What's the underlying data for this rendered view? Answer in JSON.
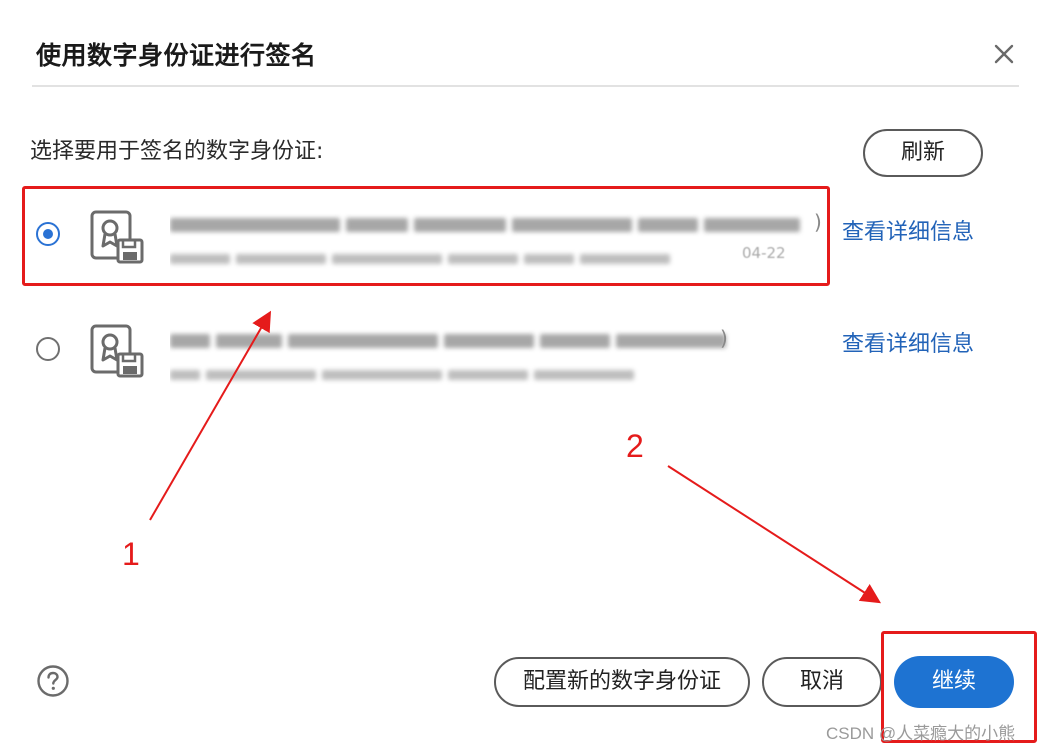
{
  "dialog": {
    "title": "使用数字身份证进行签名",
    "close_icon": "close-icon",
    "prompt": "选择要用于签名的数字身份证:",
    "refresh_label": "刷新"
  },
  "certificates": [
    {
      "selected": true,
      "icon": "certificate-icon",
      "details_label": "查看详细信息",
      "tail_line1": ")",
      "tail_line2": "04-22"
    },
    {
      "selected": false,
      "icon": "certificate-icon",
      "details_label": "查看详细信息",
      "tail_line1": ")",
      "tail_line2": ""
    }
  ],
  "footer": {
    "help_icon": "help-icon",
    "new_id_label": "配置新的数字身份证",
    "cancel_label": "取消",
    "continue_label": "继续"
  },
  "annotations": {
    "label_1": "1",
    "label_2": "2",
    "color": "#e51b1b"
  },
  "watermark": "CSDN @人菜瘾大的小熊",
  "colors": {
    "accent": "#1e73d2",
    "link": "#2263b8",
    "annotation_red": "#e51b1b"
  }
}
